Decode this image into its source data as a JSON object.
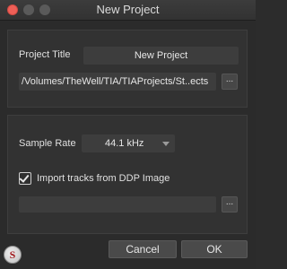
{
  "window": {
    "title": "New Project"
  },
  "project": {
    "title_label": "Project Title",
    "title_value": "New Project",
    "path_value": "/Volumes/TheWell/TIA/TIAProjects/St..ects",
    "browse_label": "..."
  },
  "settings": {
    "sample_rate_label": "Sample Rate",
    "sample_rate_value": "44.1 kHz",
    "import_label": "Import tracks from DDP Image",
    "import_checked": true,
    "ddp_path_value": "",
    "ddp_browse_label": "..."
  },
  "actions": {
    "cancel_label": "Cancel",
    "ok_label": "OK"
  },
  "watermark": {
    "text": "S"
  }
}
